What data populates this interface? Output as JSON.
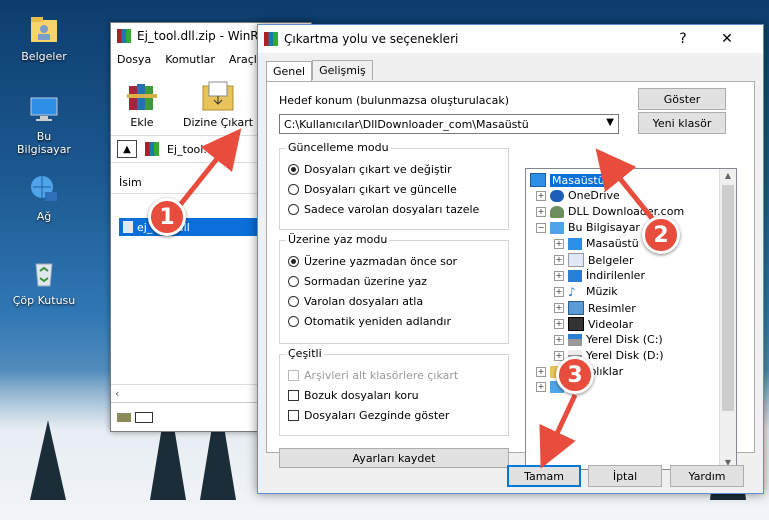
{
  "desktop": {
    "icons": [
      {
        "label": "Belgeler",
        "icon": "folder-user-icon"
      },
      {
        "label": "Bu Bilgisayar",
        "icon": "computer-icon"
      },
      {
        "label": "Ağ",
        "icon": "network-icon"
      },
      {
        "label": "Çöp Kutusu",
        "icon": "recycle-bin-icon"
      }
    ]
  },
  "winrar": {
    "title": "Ej_tool.dll.zip - WinR",
    "menu": [
      "Dosya",
      "Komutlar",
      "Araçla"
    ],
    "toolbar": {
      "add": "Ekle",
      "extract_to": "Dizine Çıkart"
    },
    "path": "Ej_tool.dll.zi",
    "column_name": "İsim",
    "file_name": "ej_tool.dll"
  },
  "dialog": {
    "title": "Çıkartma yolu ve seçenekleri",
    "help_glyph": "?",
    "close_glyph": "✕",
    "tabs": [
      "Genel",
      "Gelişmiş"
    ],
    "dest_label": "Hedef konum (bulunmazsa oluşturulacak)",
    "dest_value": "C:\\Kullanıcılar\\DllDownloader_com\\Masaüstü",
    "show_button": "Göster",
    "new_folder_button": "Yeni klasör",
    "update_mode": {
      "title": "Güncelleme modu",
      "options": [
        "Dosyaları çıkart ve değiştir",
        "Dosyaları çıkart ve güncelle",
        "Sadece varolan dosyaları tazele"
      ],
      "selected": 0
    },
    "overwrite_mode": {
      "title": "Üzerine yaz modu",
      "options": [
        "Üzerine yazmadan önce sor",
        "Sormadan üzerine yaz",
        "Varolan dosyaları atla",
        "Otomatik yeniden adlandır"
      ],
      "selected": 0
    },
    "misc": {
      "title": "Çeşitli",
      "options": [
        {
          "label": "Arşivleri alt klasörlere çıkart",
          "checked": false,
          "disabled": true
        },
        {
          "label": "Bozuk dosyaları koru",
          "checked": false,
          "disabled": false
        },
        {
          "label": "Dosyaları Gezginde göster",
          "checked": false,
          "disabled": false
        }
      ]
    },
    "save_settings_button": "Ayarları kaydet",
    "tree": [
      {
        "label": "Masaüstü",
        "level": 0,
        "icon": "desktop-icon",
        "selected": true
      },
      {
        "label": "OneDrive",
        "level": 1,
        "icon": "cloud-icon"
      },
      {
        "label": "DLL Downloader.com",
        "level": 1,
        "icon": "user-icon"
      },
      {
        "label": "Bu Bilgisayar",
        "level": 1,
        "icon": "computer-icon"
      },
      {
        "label": "Masaüstü",
        "level": 2,
        "icon": "desktop-icon"
      },
      {
        "label": "Belgeler",
        "level": 2,
        "icon": "documents-icon"
      },
      {
        "label": "İndirilenler",
        "level": 2,
        "icon": "download-icon"
      },
      {
        "label": "Müzik",
        "level": 2,
        "icon": "music-icon"
      },
      {
        "label": "Resimler",
        "level": 2,
        "icon": "pictures-icon"
      },
      {
        "label": "Videolar",
        "level": 2,
        "icon": "videos-icon"
      },
      {
        "label": "Yerel Disk (C:)",
        "level": 2,
        "icon": "drive-icon"
      },
      {
        "label": "Yerel Disk (D:)",
        "level": 2,
        "icon": "drive-icon"
      },
      {
        "label": "Kitaplıklar",
        "level": 1,
        "icon": "libraries-icon"
      },
      {
        "label": "",
        "level": 1,
        "icon": "network-icon"
      }
    ],
    "buttons": {
      "ok": "Tamam",
      "cancel": "İptal",
      "help": "Yardım"
    }
  },
  "callouts": [
    "1",
    "2",
    "3"
  ],
  "colors": {
    "selection": "#0a6fd8",
    "callout": "#e74c3c",
    "dialog_border": "#5b8fd3"
  }
}
